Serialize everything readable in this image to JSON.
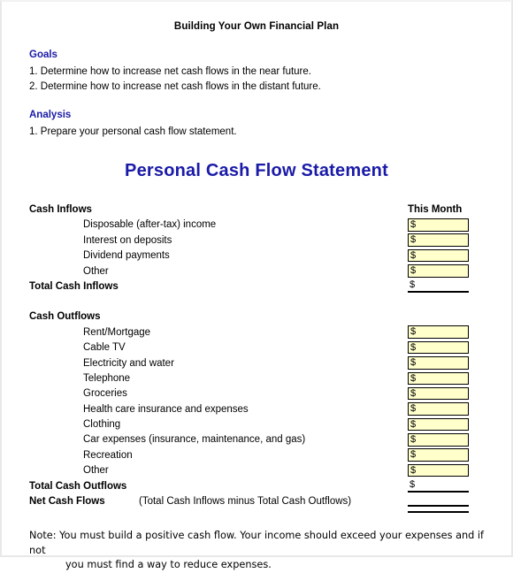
{
  "document": {
    "title": "Building Your Own Financial Plan"
  },
  "goals": {
    "heading": "Goals",
    "items": [
      "1. Determine how to increase net cash flows in the near future.",
      "2. Determine how to increase net cash flows in the distant future."
    ]
  },
  "analysis": {
    "heading": "Analysis",
    "items": [
      "1. Prepare your personal cash flow statement."
    ]
  },
  "statement": {
    "title": "Personal Cash Flow Statement",
    "column_header": "This Month",
    "currency_symbol": "$",
    "inflows": {
      "heading": "Cash Inflows",
      "items": [
        {
          "label": "Disposable (after-tax) income",
          "value": "$"
        },
        {
          "label": "Interest on deposits",
          "value": "$"
        },
        {
          "label": "Dividend payments",
          "value": "$"
        },
        {
          "label": "Other",
          "value": "$"
        }
      ],
      "total_label": "Total Cash Inflows",
      "total_value": "$"
    },
    "outflows": {
      "heading": "Cash Outflows",
      "items": [
        {
          "label": "Rent/Mortgage",
          "value": "$"
        },
        {
          "label": "Cable TV",
          "value": "$"
        },
        {
          "label": "Electricity and water",
          "value": "$"
        },
        {
          "label": "Telephone",
          "value": "$"
        },
        {
          "label": "Groceries",
          "value": "$"
        },
        {
          "label": "Health care insurance and expenses",
          "value": "$"
        },
        {
          "label": "Clothing",
          "value": "$"
        },
        {
          "label": "Car expenses (insurance, maintenance, and gas)",
          "value": "$"
        },
        {
          "label": "Recreation",
          "value": "$"
        },
        {
          "label": "Other",
          "value": "$"
        }
      ],
      "total_label": "Total Cash Outflows",
      "total_value": "$"
    },
    "net": {
      "label": "Net Cash Flows",
      "formula_note": "(Total Cash Inflows minus Total Cash Outflows)"
    }
  },
  "footer": {
    "note_line1": "Note: You must build a positive cash flow.  Your income should exceed your expenses and if not",
    "note_line2": "you must find a way to reduce expenses."
  },
  "colors": {
    "heading_blue": "#1a1aa8",
    "cell_fill": "#ffffcc",
    "cell_border": "#000000",
    "text": "#000000"
  }
}
